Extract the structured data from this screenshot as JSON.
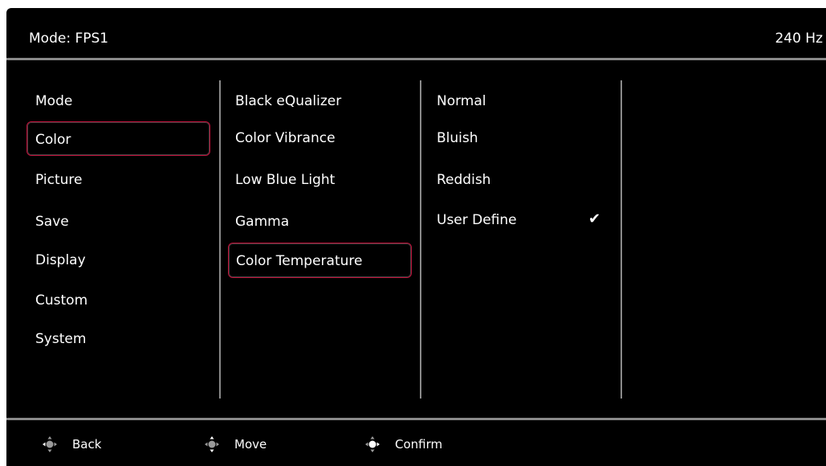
{
  "header": {
    "mode_label": "Mode: FPS1",
    "refresh_rate": "240 Hz"
  },
  "columns": {
    "main_menu": {
      "items": [
        "Mode",
        "Color",
        "Picture",
        "Save",
        "Display",
        "Custom",
        "System"
      ],
      "selected": "Color"
    },
    "submenu": {
      "items": [
        "Black eQualizer",
        "Color Vibrance",
        "Low Blue Light",
        "Gamma",
        "Color Temperature"
      ],
      "selected": "Color Temperature"
    },
    "options": {
      "items": [
        "Normal",
        "Bluish",
        "Reddish",
        "User Define"
      ],
      "checked": "User Define",
      "check_icon": "checkmark-icon"
    }
  },
  "footer": {
    "hints": [
      {
        "label": "Back",
        "icon": "joystick-left-icon"
      },
      {
        "label": "Move",
        "icon": "joystick-updown-icon"
      },
      {
        "label": "Confirm",
        "icon": "joystick-press-icon"
      }
    ]
  },
  "colors": {
    "background": "#000000",
    "text": "#ffffff",
    "divider": "#8a8a8a",
    "selection_border": "#c0103a"
  }
}
